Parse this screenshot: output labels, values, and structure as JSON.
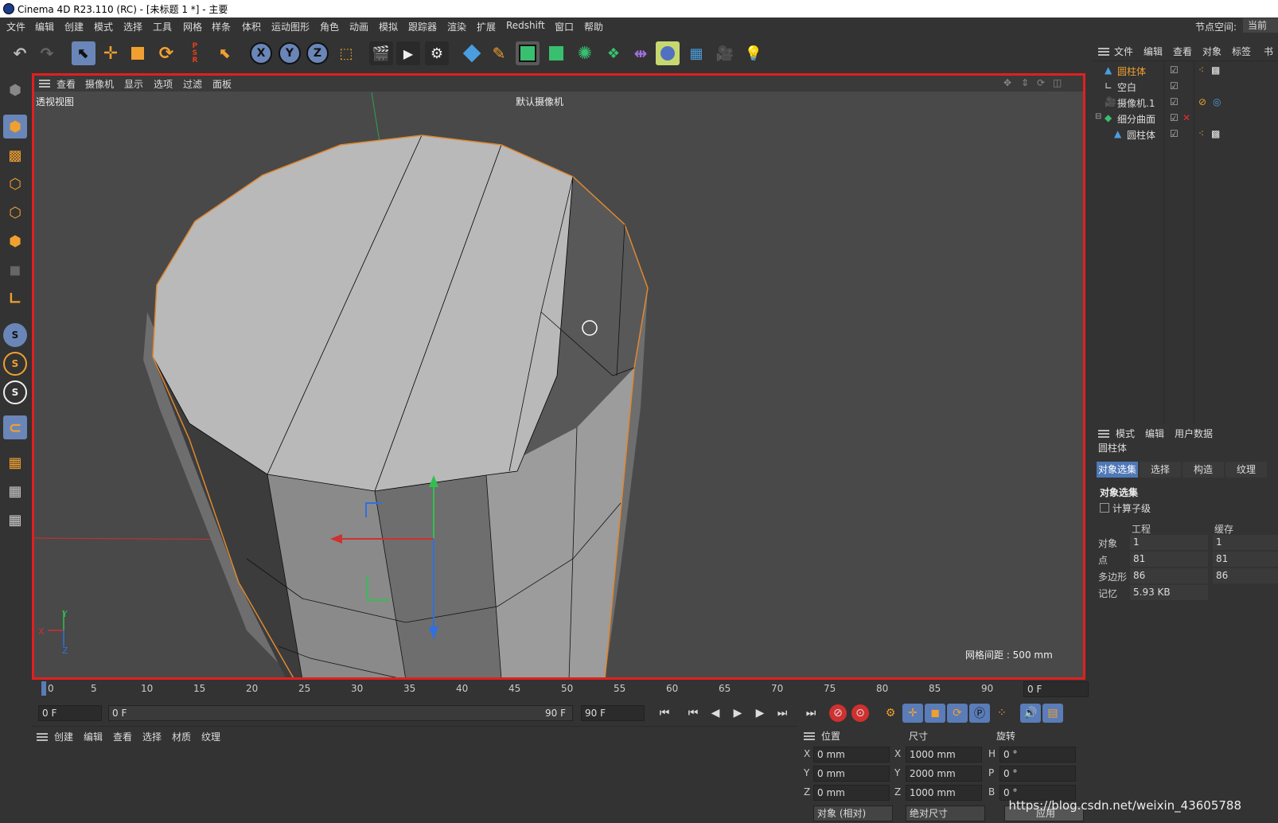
{
  "window": {
    "title": "Cinema 4D R23.110 (RC) - [未标题 1 *] - 主要"
  },
  "menubar": {
    "items": [
      "文件",
      "编辑",
      "创建",
      "模式",
      "选择",
      "工具",
      "网格",
      "样条",
      "体积",
      "运动图形",
      "角色",
      "动画",
      "模拟",
      "跟踪器",
      "渲染",
      "扩展",
      "Redshift",
      "窗口",
      "帮助"
    ],
    "node_space_label": "节点空间:",
    "node_space_value": "当前"
  },
  "toolbar": {
    "axis_x": "X",
    "axis_y": "Y",
    "axis_z": "Z"
  },
  "lefttoolbar": {
    "s1": "S",
    "s2": "S",
    "s3": "S"
  },
  "viewport": {
    "menu": [
      "查看",
      "摄像机",
      "显示",
      "选项",
      "过滤",
      "面板"
    ],
    "view_name": "透视视图",
    "camera": "默认摄像机",
    "grid_spacing": "网格间距 : 500 mm",
    "axis_labels": {
      "x": "X",
      "y": "Y",
      "z": "Z"
    }
  },
  "timeline": {
    "ticks": [
      "0",
      "5",
      "10",
      "15",
      "20",
      "25",
      "30",
      "35",
      "40",
      "45",
      "50",
      "55",
      "60",
      "65",
      "70",
      "75",
      "80",
      "85",
      "90"
    ],
    "current_frame": "0 F",
    "start": "0 F",
    "range_start": "0 F",
    "range_end": "90 F",
    "end": "90 F"
  },
  "material_panel": {
    "menu": [
      "创建",
      "编辑",
      "查看",
      "选择",
      "材质",
      "纹理"
    ]
  },
  "coords": {
    "headers": {
      "position": "位置",
      "size": "尺寸",
      "rotation": "旋转"
    },
    "rows": [
      {
        "axis": "X",
        "pos": "0 mm",
        "saxis": "X",
        "size": "1000 mm",
        "raxis": "H",
        "rot": "0 °"
      },
      {
        "axis": "Y",
        "pos": "0 mm",
        "saxis": "Y",
        "size": "2000 mm",
        "raxis": "P",
        "rot": "0 °"
      },
      {
        "axis": "Z",
        "pos": "0 mm",
        "saxis": "Z",
        "size": "1000 mm",
        "raxis": "B",
        "rot": "0 °"
      }
    ],
    "mode": "对象 (相对)",
    "size_mode": "绝对尺寸",
    "apply": "应用"
  },
  "object_manager": {
    "menu": [
      "文件",
      "编辑",
      "查看",
      "对象",
      "标签",
      "书"
    ],
    "objects": [
      {
        "name": "圆柱体",
        "color": "#f0a030"
      },
      {
        "name": "空白",
        "color": "#dddddd"
      },
      {
        "name": "摄像机.1",
        "color": "#dddddd"
      },
      {
        "name": "细分曲面",
        "color": "#dddddd"
      },
      {
        "name": "圆柱体",
        "color": "#dddddd"
      }
    ]
  },
  "attributes": {
    "menu": [
      "模式",
      "编辑",
      "用户数据"
    ],
    "object_name": "圆柱体",
    "tabs": [
      "对象选集",
      "选择",
      "构造",
      "纹理"
    ],
    "section": "对象选集",
    "checkbox_label": "计算子级",
    "col1": "工程",
    "col2": "缓存",
    "rows": [
      {
        "k": "对象",
        "v1": "1",
        "v2": "1"
      },
      {
        "k": "点",
        "v1": "81",
        "v2": "81"
      },
      {
        "k": "多边形",
        "v1": "86",
        "v2": "86"
      },
      {
        "k": "记忆",
        "v1": "5.93 KB",
        "v2": ""
      }
    ]
  },
  "watermark": "https://blog.csdn.net/weixin_43605788"
}
